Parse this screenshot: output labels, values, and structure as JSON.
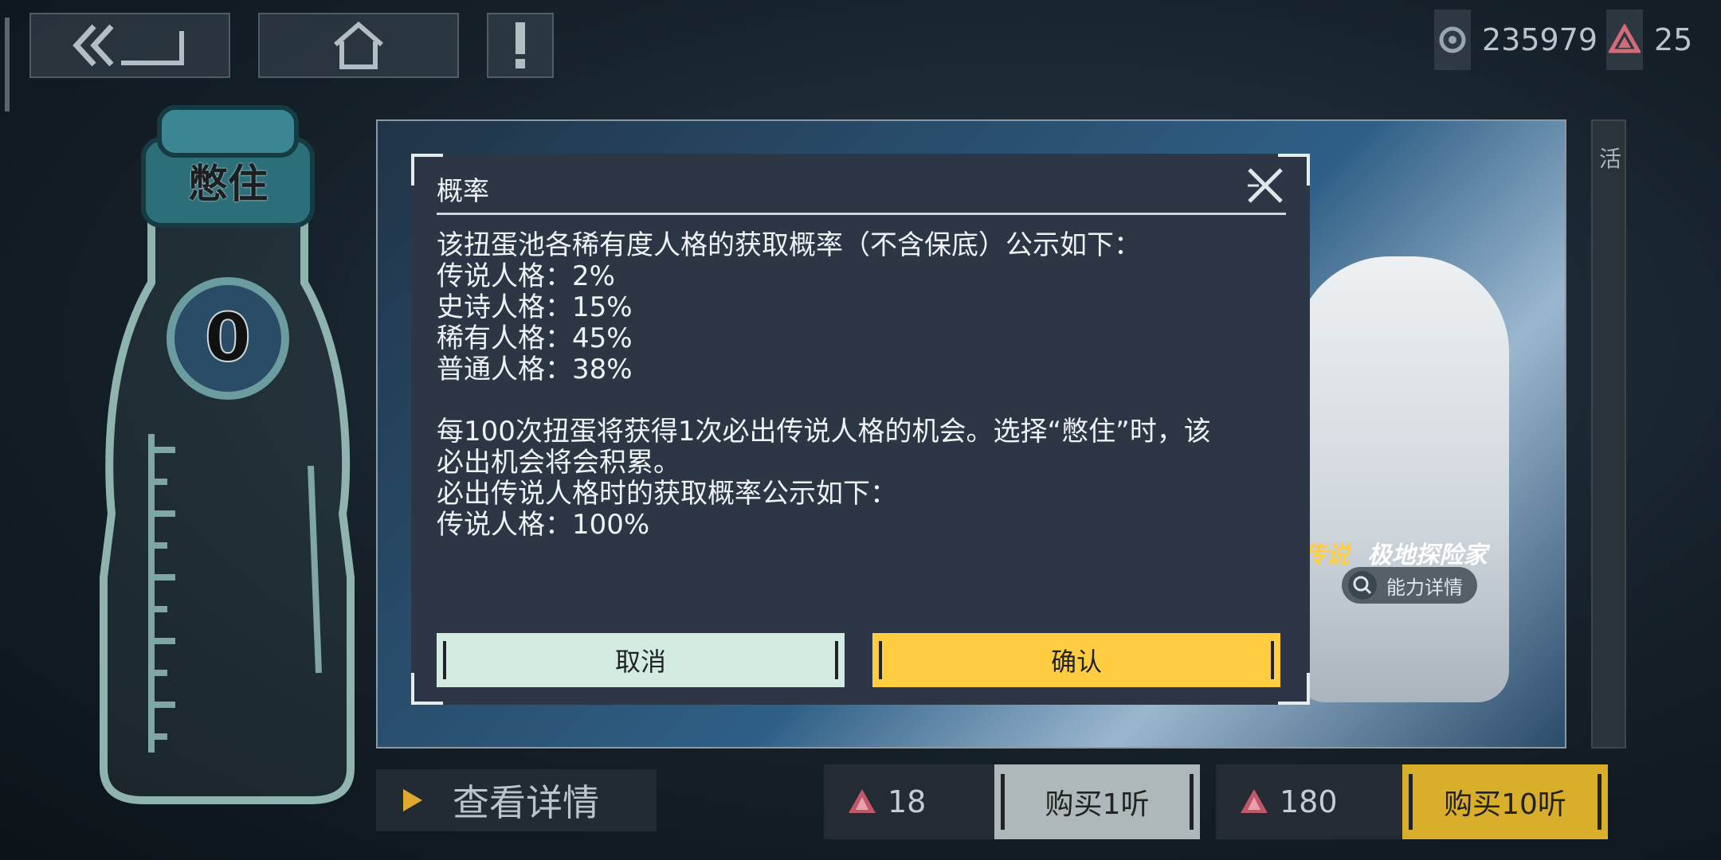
{
  "nav": {
    "back_icon": "double-chevron-back-icon",
    "home_icon": "home-icon",
    "notice_icon": "exclamation-icon"
  },
  "currency": {
    "coins": "235979",
    "gems": "25"
  },
  "bottle": {
    "label": "憋住",
    "count": "0"
  },
  "banner": {
    "rarity": "传说",
    "character_name": "极地探险家",
    "ability_detail": "能力详情",
    "side_tab_text": "活"
  },
  "dialog": {
    "title": "概率",
    "lines": [
      "该扭蛋池各稀有度人格的获取概率（不含保底）公示如下：",
      "传说人格：2%",
      "史诗人格：15%",
      "稀有人格：45%",
      "普通人格：38%",
      "",
      "每100次扭蛋将获得1次必出传说人格的机会。选择“憋住”时，该",
      "必出机会将会积累。",
      "必出传说人格时的获取概率公示如下：",
      "传说人格：100%"
    ],
    "cancel_label": "取消",
    "confirm_label": "确认"
  },
  "bottom": {
    "detail_label": "查看详情",
    "buy1": {
      "cost": "18",
      "label": "购买1听"
    },
    "buy10": {
      "cost": "180",
      "label": "购买10听"
    }
  },
  "colors": {
    "confirm": "#ffcd3f",
    "cancel": "#d4ebe1",
    "dialog_bg": "#2c3645",
    "buy10": "#d9ae2b",
    "buy1": "#aeb8ba"
  }
}
